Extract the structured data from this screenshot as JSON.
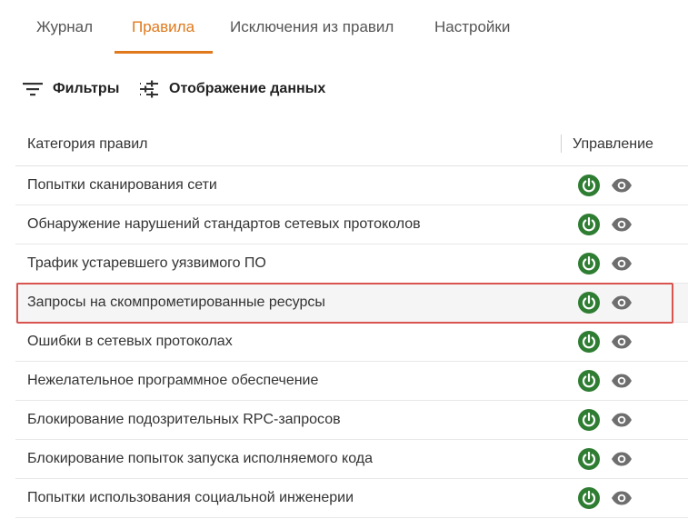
{
  "tabs": [
    {
      "label": "Журнал",
      "active": false
    },
    {
      "label": "Правила",
      "active": true
    },
    {
      "label": "Исключения из правил",
      "active": false
    },
    {
      "label": "Настройки",
      "active": false
    }
  ],
  "toolbar": {
    "filters_label": "Фильтры",
    "display_label": "Отображение данных"
  },
  "table": {
    "columns": {
      "category": "Категория правил",
      "control": "Управление"
    },
    "rows": [
      {
        "label": "Попытки сканирования сети",
        "enabled": true,
        "highlighted": false
      },
      {
        "label": "Обнаружение нарушений стандартов сетевых протоколов",
        "enabled": true,
        "highlighted": false
      },
      {
        "label": "Трафик устаревшего уязвимого ПО",
        "enabled": true,
        "highlighted": false
      },
      {
        "label": "Запросы на скомпрометированные ресурсы",
        "enabled": true,
        "highlighted": true
      },
      {
        "label": "Ошибки в сетевых протоколах",
        "enabled": true,
        "highlighted": false
      },
      {
        "label": "Нежелательное программное обеспечение",
        "enabled": true,
        "highlighted": false
      },
      {
        "label": "Блокирование подозрительных RPC-запросов",
        "enabled": true,
        "highlighted": false
      },
      {
        "label": "Блокирование попыток запуска исполняемого кода",
        "enabled": true,
        "highlighted": false
      },
      {
        "label": "Попытки использования социальной инженерии",
        "enabled": true,
        "highlighted": false
      }
    ]
  },
  "colors": {
    "accent": "#e0791c",
    "power_on": "#2e7d32",
    "highlight_border": "#d9534f",
    "eye_icon": "#6e6e6e"
  },
  "icons": {
    "filters": "filter-lines-icon",
    "display": "tune-sliders-icon",
    "power": "power-icon",
    "view": "eye-icon"
  }
}
